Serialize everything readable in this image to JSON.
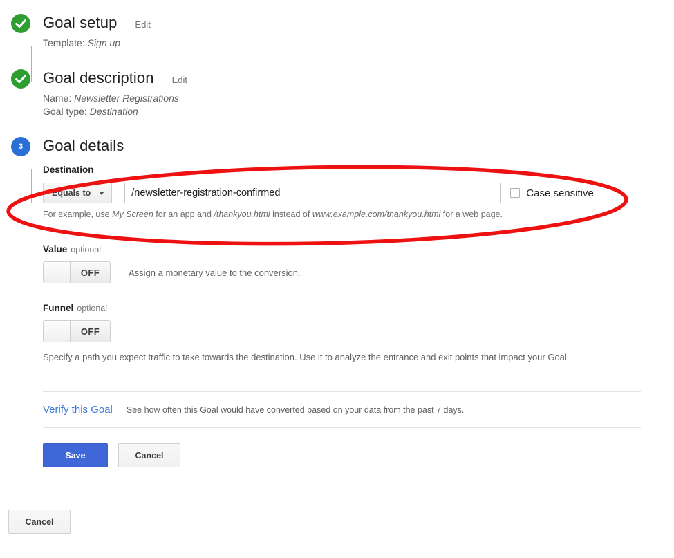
{
  "steps": [
    {
      "number": "1",
      "state": "done",
      "title": "Goal setup",
      "edit_label": "Edit",
      "summary_label": "Template:",
      "summary_value": "Sign up"
    },
    {
      "number": "2",
      "state": "done",
      "title": "Goal description",
      "edit_label": "Edit",
      "summary_label": "Name:",
      "summary_value": "Newsletter Registrations",
      "summary_label2": "Goal type:",
      "summary_value2": "Destination"
    },
    {
      "number": "3",
      "state": "current",
      "title": "Goal details"
    }
  ],
  "destination": {
    "label": "Destination",
    "match_type": "Equals to",
    "url_value": "/newsletter-registration-confirmed",
    "url_placeholder": "",
    "case_sensitive_label": "Case sensitive",
    "case_sensitive_checked": false,
    "help_prefix": "For example, use ",
    "help_italic1": "My Screen",
    "help_mid1": " for an app and ",
    "help_italic2": "/thankyou.html",
    "help_mid2": " instead of ",
    "help_italic3": "www.example.com/thankyou.html",
    "help_suffix": " for a web page."
  },
  "value_section": {
    "label": "Value",
    "optional": "optional",
    "toggle_state": "OFF",
    "description": "Assign a monetary value to the conversion."
  },
  "funnel_section": {
    "label": "Funnel",
    "optional": "optional",
    "toggle_state": "OFF",
    "description": "Specify a path you expect traffic to take towards the destination. Use it to analyze the entrance and exit points that impact your Goal."
  },
  "verify": {
    "link_label": "Verify this Goal",
    "description": "See how often this Goal would have converted based on your data from the past 7 days."
  },
  "actions": {
    "save_label": "Save",
    "cancel_label": "Cancel",
    "bottom_cancel_label": "Cancel"
  },
  "colors": {
    "step_done": "#2e9e32",
    "step_current": "#2a6fd6",
    "primary_button": "#4067d8",
    "link": "#3b78d8",
    "annotation": "#EE1111"
  }
}
